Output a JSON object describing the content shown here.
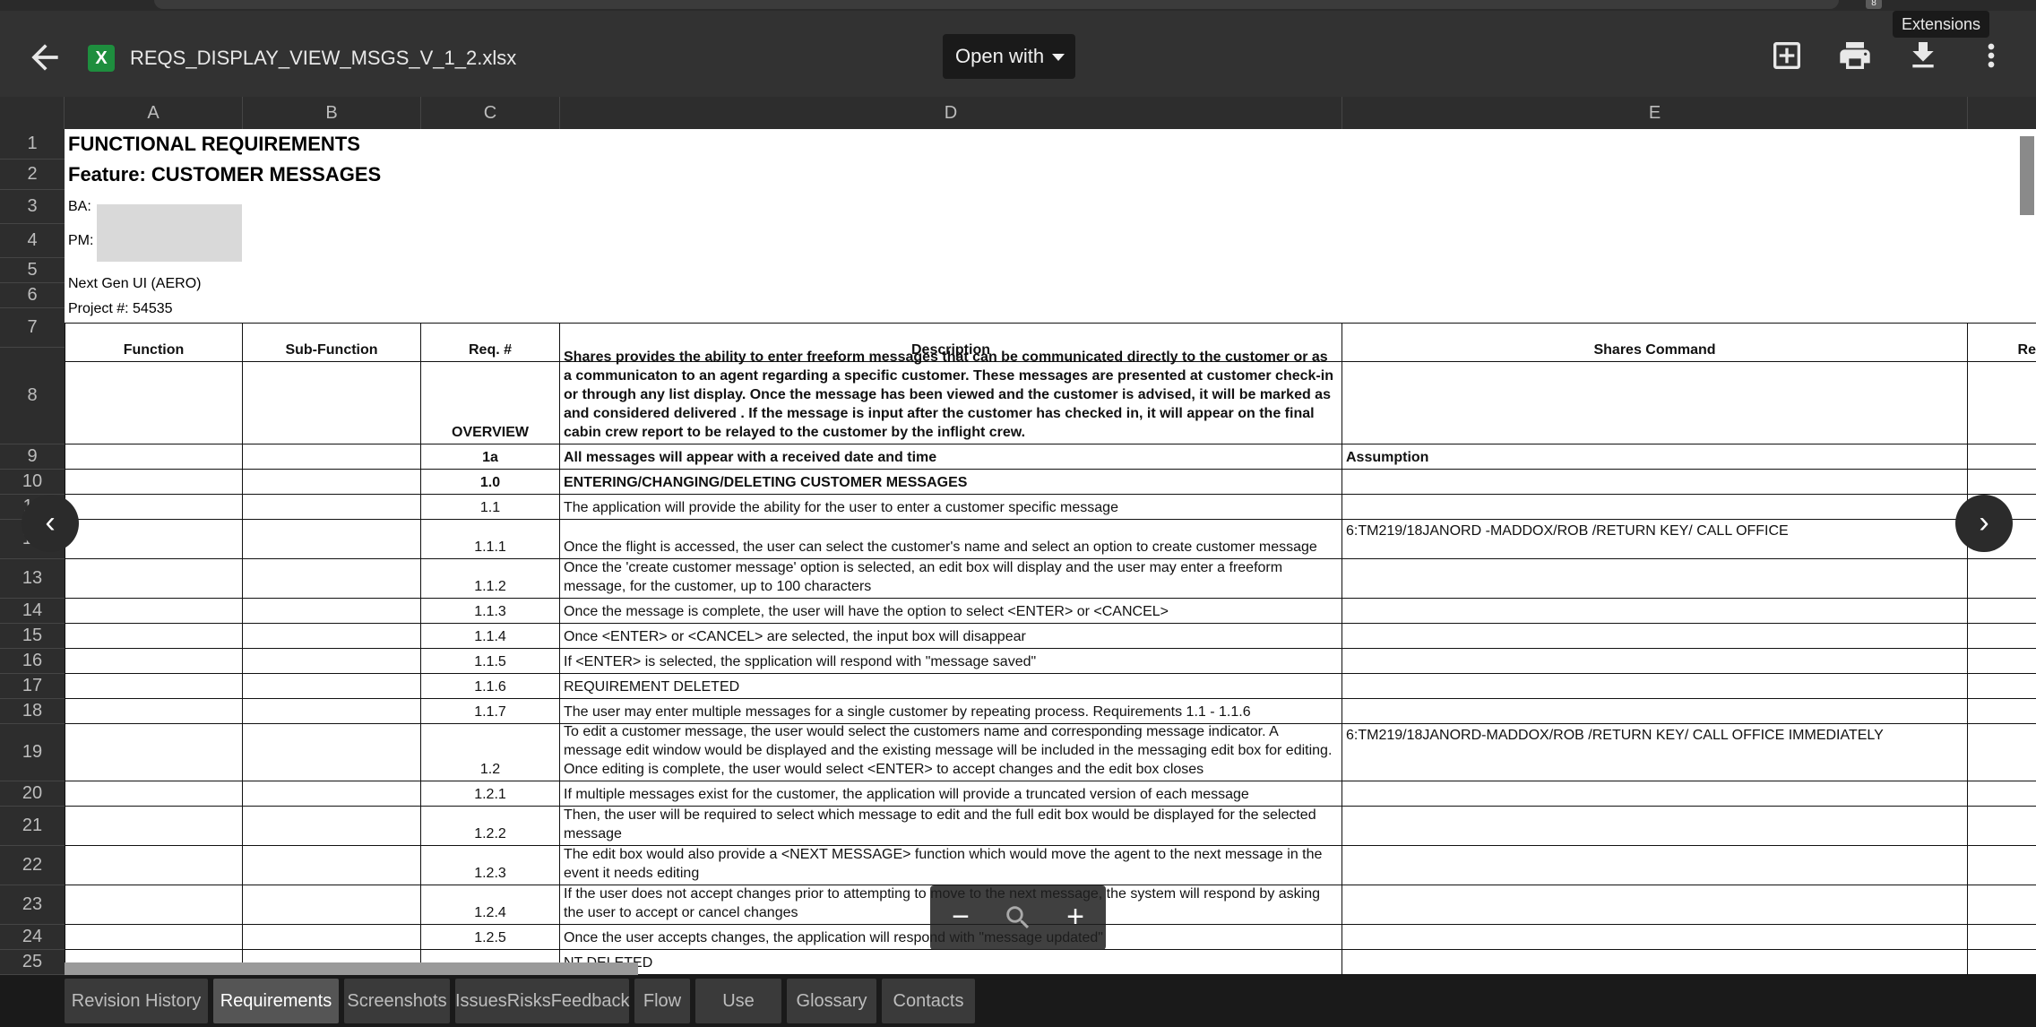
{
  "browser": {
    "tooltip": "Extensions",
    "ext_badge": "8"
  },
  "topbar": {
    "file_name": "REQS_DISPLAY_VIEW_MSGS_V_1_2.xlsx",
    "file_icon_letter": "X",
    "open_with_label": "Open with"
  },
  "columns": [
    "A",
    "B",
    "C",
    "D",
    "E"
  ],
  "row_numbers": [
    "1",
    "2",
    "3",
    "4",
    "5",
    "6",
    "7",
    "8",
    "9",
    "10",
    "11",
    "12",
    "13",
    "14",
    "15",
    "16",
    "17",
    "18",
    "19",
    "20",
    "21",
    "22",
    "23",
    "24",
    "25"
  ],
  "header_block": {
    "title": "FUNCTIONAL REQUIREMENTS",
    "feature": "Feature: CUSTOMER MESSAGES",
    "ba_label": "BA:",
    "pm_label": "PM:",
    "project_name": "Next Gen UI (AERO)",
    "project_number": "Project #: 54535"
  },
  "table_headers": {
    "function": "Function",
    "sub_function": "Sub-Function",
    "req": "Req. #",
    "description": "Description",
    "shares_command": "Shares Command",
    "next_col": "Re"
  },
  "rows": [
    {
      "req": "OVERVIEW",
      "desc": "Shares provides the ability to enter freeform messages that can be communicated directly to the customer or as a communicaton to an agent regarding a specific customer.  These messages are presented at customer check-in or through any list display.  Once the message has been viewed and the customer is advised, it will be marked as and considered delivered .  If the message is input after the customer has checked in, it will appear on the final cabin crew report to be relayed to the customer by the inflight crew.",
      "cmd": ""
    },
    {
      "req": "1a",
      "desc": "All messages will appear with a received date and time",
      "cmd": "Assumption"
    },
    {
      "req": "1.0",
      "desc": "ENTERING/CHANGING/DELETING CUSTOMER MESSAGES",
      "cmd": ""
    },
    {
      "req": "1.1",
      "desc": "The application will provide the ability for the user to enter a customer specific message",
      "cmd": ""
    },
    {
      "req": "1.1.1",
      "desc": "Once the flight is accessed, the user can select the customer's name and select an option to create customer message",
      "cmd": "6:TM219/18JANORD -MADDOX/ROB  /RETURN KEY/ CALL OFFICE"
    },
    {
      "req": "1.1.2",
      "desc": "Once the 'create customer message' option is selected, an edit box will display and the user may enter a freeform message, for the customer, up to 100 characters",
      "cmd": ""
    },
    {
      "req": "1.1.3",
      "desc": "Once the message is complete, the user will have the option to select <ENTER> or <CANCEL>",
      "cmd": ""
    },
    {
      "req": "1.1.4",
      "desc": "Once <ENTER> or <CANCEL> are selected, the input box will disappear",
      "cmd": ""
    },
    {
      "req": "1.1.5",
      "desc": "If <ENTER> is selected, the spplication will respond with \"message saved\"",
      "cmd": ""
    },
    {
      "req": "1.1.6",
      "desc": "REQUIREMENT DELETED",
      "cmd": ""
    },
    {
      "req": "1.1.7",
      "desc": "The user may enter multiple messages for a single customer by repeating process.  Requirements 1.1 - 1.1.6",
      "cmd": ""
    },
    {
      "req": "1.2",
      "desc": "To edit a customer message, the user would select the customers name and corresponding message indicator.  A message edit window would be displayed and the existing message will be included in the messaging edit box for editing. Once editing is complete, the user would select <ENTER> to accept changes and the edit box closes",
      "cmd": "6:TM219/18JANORD-MADDOX/ROB /RETURN KEY/ CALL OFFICE IMMEDIATELY"
    },
    {
      "req": "1.2.1",
      "desc": "If multiple messages exist for the customer, the application will provide a truncated version of each message",
      "cmd": ""
    },
    {
      "req": "1.2.2",
      "desc": "Then, the user will be required to select which message to edit and the full edit box would be displayed for the selected message",
      "cmd": ""
    },
    {
      "req": "1.2.3",
      "desc": "The edit box would also provide a <NEXT MESSAGE> function which would move the agent to the next message in the event it needs editing",
      "cmd": ""
    },
    {
      "req": "1.2.4",
      "desc": "If the user does not accept changes prior to attempting to move to the next message, the system will respond by asking the user to accept or cancel changes",
      "cmd": ""
    },
    {
      "req": "1.2.5",
      "desc": "Once the user accepts changes, the application will respond with \"message updated\"",
      "cmd": ""
    },
    {
      "req": "",
      "desc": "NT DELETED",
      "cmd": ""
    }
  ],
  "tabs": [
    "Revision History",
    "Requirements",
    "Screenshots",
    "IssuesRisksFeedback",
    "Flow",
    "Use Cases",
    "Glossary",
    "Contacts"
  ],
  "active_tab": "Requirements",
  "icons": {
    "back": "arrow-left-icon",
    "add": "add-to-drive-icon",
    "print": "print-icon",
    "download": "download-icon",
    "more": "more-vert-icon",
    "zoom": "zoom-icon"
  }
}
